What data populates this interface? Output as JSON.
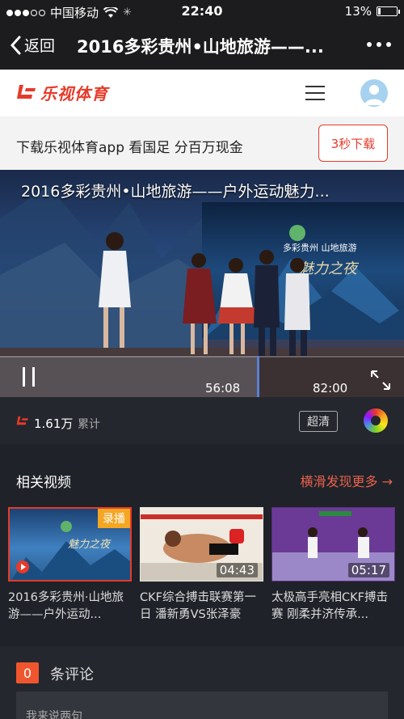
{
  "status_bar": {
    "carrier": "中国移动",
    "time": "22:40",
    "battery": "13%",
    "battery_level": 0.13
  },
  "nav": {
    "back_label": "返回",
    "title": "2016多彩贵州•山地旅游——..."
  },
  "brand": {
    "logo_text": "乐视体育",
    "accent": "#e63a2a"
  },
  "download_banner": {
    "text": "下载乐视体育app 看国足 分百万现金",
    "button_label": "3秒下载"
  },
  "video": {
    "title": "2016多彩贵州•山地旅游——户外运动魅力...",
    "current_time": "56:08",
    "total_time": "82:00",
    "progress": 0.684
  },
  "info": {
    "views": "1.61万",
    "views_label": "累计",
    "quality": "超清"
  },
  "related": {
    "heading": "相关视频",
    "more_label": "横滑发现更多 →",
    "items": [
      {
        "title": "2016多彩贵州·山地旅游——户外运动...",
        "badge": "录播",
        "duration": ""
      },
      {
        "title": "CKF综合搏击联赛第一日 潘新勇VS张泽豪",
        "badge": "",
        "duration": "04:43"
      },
      {
        "title": "太极高手亮相CKF搏击赛 刚柔并济传承...",
        "badge": "",
        "duration": "05:17"
      }
    ]
  },
  "comments": {
    "count": "0",
    "label": "条评论",
    "placeholder": "我来说两句"
  }
}
